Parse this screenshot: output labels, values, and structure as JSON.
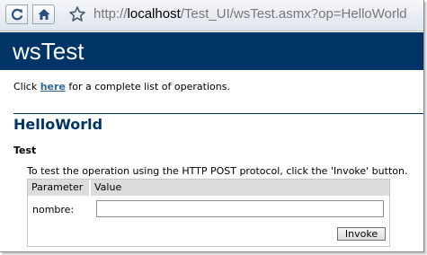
{
  "browser": {
    "url_prefix": "http://",
    "url_host": "localhost",
    "url_path": "/Test_UI/wsTest.asmx?op=HelloWorld",
    "icons": [
      "reload-icon",
      "home-icon",
      "star-icon"
    ]
  },
  "service": {
    "title": "wsTest"
  },
  "intro": {
    "before": "Click ",
    "link": "here",
    "after": " for a complete list of operations."
  },
  "operation": {
    "name": "HelloWorld",
    "test_heading": "Test",
    "test_description": "To test the operation using the HTTP POST protocol, click the 'Invoke' button."
  },
  "params_table": {
    "headers": [
      "Parameter",
      "Value"
    ],
    "rows": [
      {
        "label": "nombre:",
        "value": ""
      }
    ],
    "invoke_label": "Invoke"
  },
  "colors": {
    "header_bg": "#003366",
    "header_text": "#ffffff",
    "link": "#336699",
    "table_header_bg": "#dcdcdc"
  }
}
